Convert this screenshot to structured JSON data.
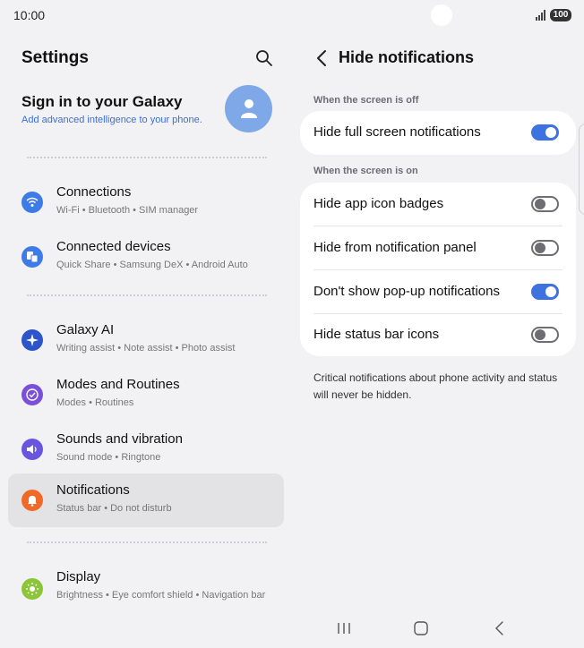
{
  "status": {
    "time": "10:00",
    "battery": "100"
  },
  "left": {
    "title": "Settings",
    "account": {
      "title": "Sign in to your Galaxy",
      "subtitle": "Add advanced intelligence to your phone."
    },
    "items": [
      {
        "id": "connections",
        "title": "Connections",
        "subtitle": "Wi-Fi  •  Bluetooth  •  SIM manager",
        "color": "#3d7be6",
        "icon": "wifi-icon"
      },
      {
        "id": "connected-devices",
        "title": "Connected devices",
        "subtitle": "Quick Share  •  Samsung DeX  •  Android Auto",
        "color": "#3d7be6",
        "icon": "devices-icon"
      },
      {
        "id": "galaxy-ai",
        "title": "Galaxy AI",
        "subtitle": "Writing assist  •  Note assist  •  Photo assist",
        "color": "#2d54c8",
        "icon": "sparkle-icon"
      },
      {
        "id": "modes-routines",
        "title": "Modes and Routines",
        "subtitle": "Modes  •  Routines",
        "color": "#7a4fd9",
        "icon": "check-circle-icon"
      },
      {
        "id": "sounds-vibration",
        "title": "Sounds and vibration",
        "subtitle": "Sound mode  •  Ringtone",
        "color": "#6a55df",
        "icon": "speaker-icon"
      },
      {
        "id": "notifications",
        "title": "Notifications",
        "subtitle": "Status bar  •  Do not disturb",
        "color": "#f06a27",
        "icon": "bell-icon"
      },
      {
        "id": "display",
        "title": "Display",
        "subtitle": "Brightness  •  Eye comfort shield  •  Navigation bar",
        "color": "#8cc53a",
        "icon": "sun-icon"
      }
    ]
  },
  "right": {
    "title": "Hide notifications",
    "section_off": "When the screen is off",
    "section_on": "When the screen is on",
    "off_rows": [
      {
        "label": "Hide full screen notifications",
        "on": true
      }
    ],
    "on_rows": [
      {
        "label": "Hide app icon badges",
        "on": false
      },
      {
        "label": "Hide from notification panel",
        "on": false
      },
      {
        "label": "Don't show pop-up notifications",
        "on": true
      },
      {
        "label": "Hide status bar icons",
        "on": false
      }
    ],
    "footnote": "Critical notifications about phone activity and status will never be hidden."
  },
  "colors": {
    "accent": "#3e72e0",
    "link": "#3a6fd8",
    "background": "#f2f2f4"
  }
}
